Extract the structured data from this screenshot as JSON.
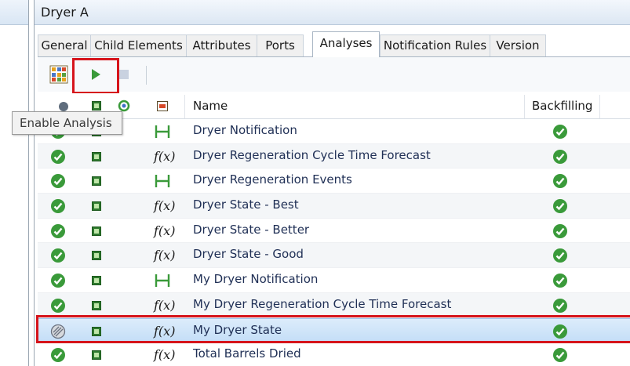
{
  "window": {
    "title": "Dryer A"
  },
  "tabs": [
    {
      "label": "General",
      "active": false
    },
    {
      "label": "Child Elements",
      "active": false
    },
    {
      "label": "Attributes",
      "active": false
    },
    {
      "label": "Ports",
      "active": false
    },
    {
      "label": "Analyses",
      "active": true
    },
    {
      "label": "Notification Rules",
      "active": false
    },
    {
      "label": "Version",
      "active": false
    }
  ],
  "toolbar": {
    "buttons": [
      {
        "icon": "analysis-templates-icon"
      },
      {
        "icon": "play-icon",
        "highlighted": true
      },
      {
        "icon": "stop-icon",
        "disabled": true
      }
    ]
  },
  "tooltip": {
    "text": "Enable Analysis"
  },
  "grid": {
    "columns": {
      "name": "Name",
      "backfilling": "Backfilling"
    },
    "rows": [
      {
        "status": "running",
        "type": "notification",
        "name": "Dryer Notification",
        "backfilling": true
      },
      {
        "status": "running",
        "type": "expression",
        "name": "Dryer Regeneration Cycle Time Forecast",
        "backfilling": true
      },
      {
        "status": "running",
        "type": "notification",
        "name": "Dryer Regeneration Events",
        "backfilling": true
      },
      {
        "status": "running",
        "type": "expression",
        "name": "Dryer State - Best",
        "backfilling": true
      },
      {
        "status": "running",
        "type": "expression",
        "name": "Dryer State - Better",
        "backfilling": true
      },
      {
        "status": "running",
        "type": "expression",
        "name": "Dryer State - Good",
        "backfilling": true
      },
      {
        "status": "running",
        "type": "notification",
        "name": "My Dryer Notification",
        "backfilling": true
      },
      {
        "status": "running",
        "type": "expression",
        "name": "My Dryer Regeneration Cycle Time Forecast",
        "backfilling": true
      },
      {
        "status": "disabled",
        "type": "expression",
        "name": "My Dryer State",
        "backfilling": true,
        "selected": true
      },
      {
        "status": "running",
        "type": "expression",
        "name": "Total Barrels Dried",
        "backfilling": true
      }
    ]
  },
  "colors": {
    "accent_green": "#3a9a3a",
    "highlight_red": "#d6141b",
    "selection_blue": "#c4def7"
  }
}
